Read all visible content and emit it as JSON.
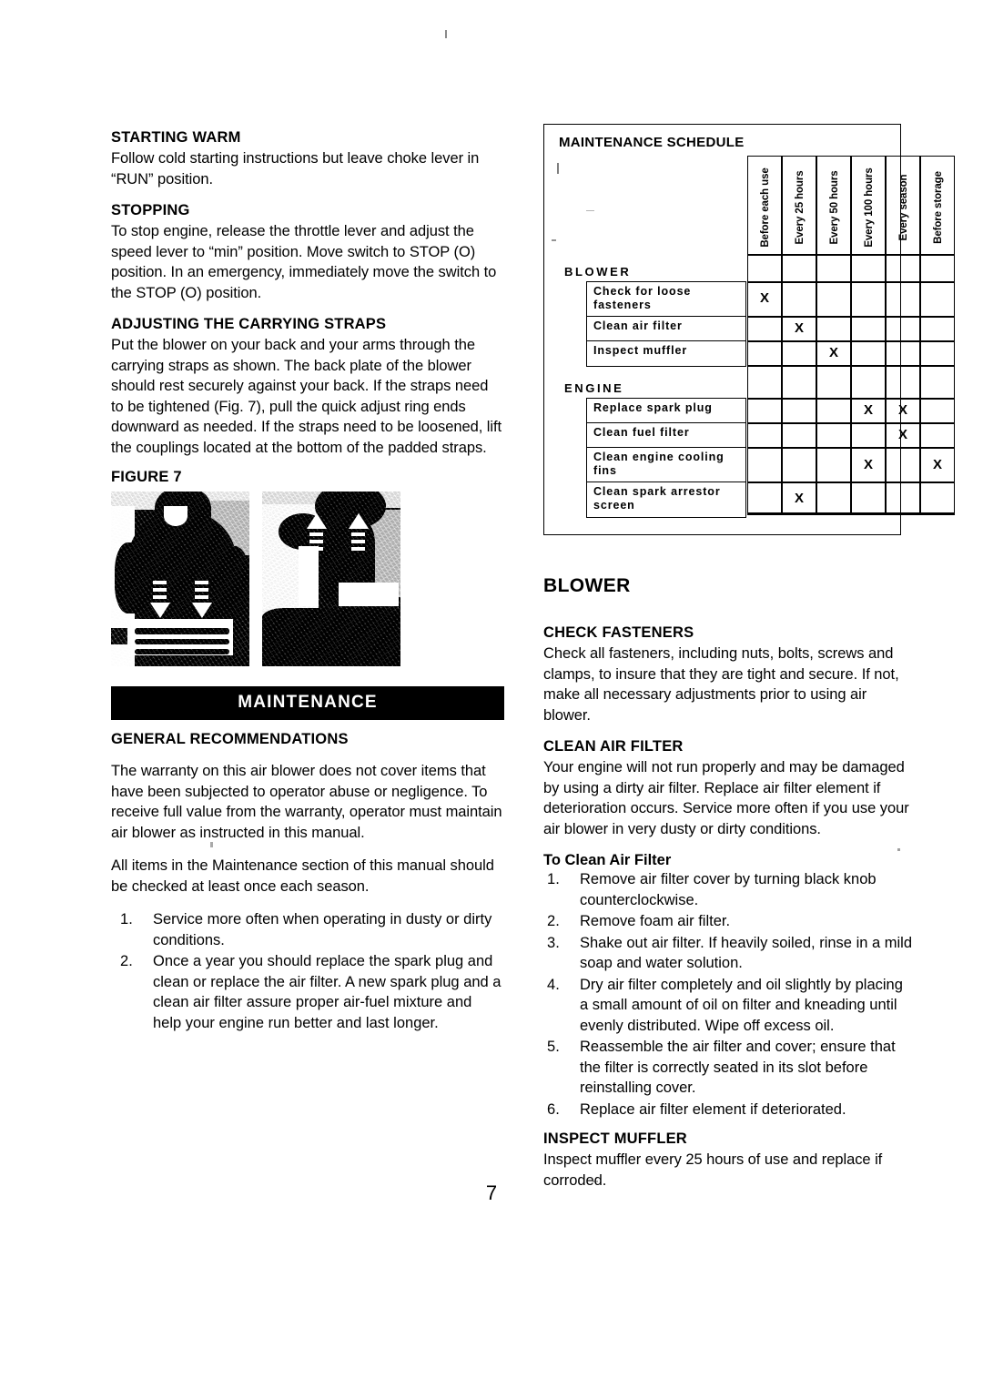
{
  "page": {
    "number": "7"
  },
  "left_column": {
    "sections": [
      {
        "heading": "STARTING WARM",
        "body": "Follow cold starting instructions but leave choke lever in “RUN”  position."
      },
      {
        "heading": "STOPPING",
        "body": "To stop engine, release the throttle lever and adjust the speed lever to “min” position. Move switch to STOP (O) position. In an emergency, immediately move the switch to the STOP (O) position."
      },
      {
        "heading": "ADJUSTING THE CARRYING STRAPS",
        "body": "Put the blower on your back and your arms through the carrying straps as shown. The back plate of the blower should rest securely against your back. If the straps need to be tightened (Fig. 7), pull the quick adjust ring ends downward as needed. If the straps need to be loosened, lift the couplings located at the bottom of the padded straps."
      }
    ],
    "figure_label": "FIGURE 7",
    "figure_caption_photos": [
      "backpack-blower-straps-tighten",
      "backpack-blower-straps-loosen"
    ],
    "banner": "MAINTENANCE",
    "general": {
      "heading": "GENERAL RECOMMENDATIONS",
      "paragraphs": [
        "The warranty on this air blower does not cover items that have been subjected to operator abuse or negligence. To receive full value from the warranty, operator must maintain air blower as instructed in this manual.",
        "All items in the Maintenance section of this manual should be checked at least once each season."
      ],
      "items": [
        "Service more often when operating in dusty or dirty conditions.",
        "Once a year you should replace the spark plug and clean or replace the air filter. A new spark plug and a clean air filter assure proper air-fuel mixture and help your engine run better and last longer."
      ]
    }
  },
  "schedule": {
    "title": "MAINTENANCE SCHEDULE",
    "columns": [
      "Before each use",
      "Every 25 hours",
      "Every 50 hours",
      "Every 100 hours",
      "Every season",
      "Before storage"
    ],
    "groups": [
      {
        "name": "BLOWER",
        "rows": [
          {
            "task": "Check for loose fasteners",
            "marks": [
              true,
              false,
              false,
              false,
              false,
              false
            ]
          },
          {
            "task": "Clean air filter",
            "marks": [
              false,
              true,
              false,
              false,
              false,
              false
            ]
          },
          {
            "task": "Inspect muffler",
            "marks": [
              false,
              false,
              true,
              false,
              false,
              false
            ]
          }
        ]
      },
      {
        "name": "ENGINE",
        "rows": [
          {
            "task": "Replace spark plug",
            "marks": [
              false,
              false,
              false,
              true,
              true,
              false
            ]
          },
          {
            "task": "Clean fuel filter",
            "marks": [
              false,
              false,
              false,
              false,
              true,
              false
            ]
          },
          {
            "task": "Clean engine cooling fins",
            "marks": [
              false,
              false,
              false,
              true,
              false,
              true
            ]
          },
          {
            "task": "Clean spark arrestor screen",
            "marks": [
              false,
              true,
              false,
              false,
              false,
              false
            ]
          }
        ]
      }
    ],
    "mark_symbol": "X"
  },
  "right_column": {
    "title": "BLOWER",
    "sections": [
      {
        "heading": "CHECK FASTENERS",
        "body": "Check all fasteners, including nuts, bolts, screws and clamps, to insure that they are tight and secure. If not, make all necessary adjustments prior to using air blower."
      },
      {
        "heading": "CLEAN AIR FILTER",
        "body": "Your engine will not run properly and may be damaged by using a dirty air filter. Replace air filter element if deterioration occurs. Service more often if you use your air blower in very dusty or dirty conditions."
      }
    ],
    "subheading": "To Clean Air Filter",
    "clean_steps": [
      "Remove air filter cover by turning black knob  counterclockwise.",
      "Remove foam  air filter.",
      "Shake out air filter. If heavily soiled, rinse in a mild soap and water solution.",
      "Dry air filter completely and oil slightly by placing a small amount of oil on filter and kneading until evenly distributed. Wipe off excess oil.",
      "Reassemble the air filter and cover; ensure that the filter is correctly seated in its slot before reinstalling cover.",
      "Replace air filter element if deteriorated."
    ],
    "muffler": {
      "heading": "INSPECT MUFFLER",
      "body": "Inspect muffler every 25 hours of use and replace if corroded."
    }
  }
}
